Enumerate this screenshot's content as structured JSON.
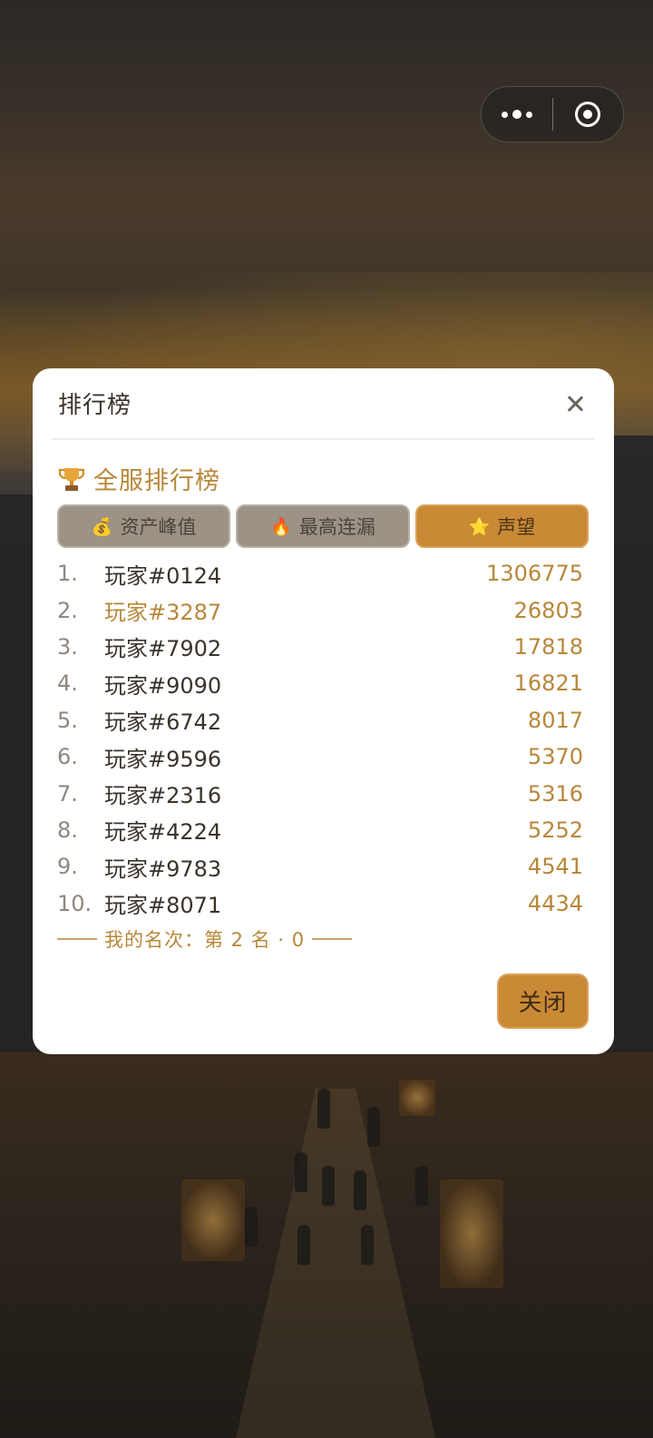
{
  "capsule": {
    "more_icon": "more-dots-icon",
    "close_icon": "target-circle-icon"
  },
  "modal": {
    "title": "排行榜",
    "close_icon": "close-x-icon",
    "section_title": "全服排行榜",
    "section_icon": "trophy-icon",
    "tabs": [
      {
        "emoji": "💰",
        "label": "资产峰值",
        "active": false
      },
      {
        "emoji": "🔥",
        "label": "最高连漏",
        "active": false
      },
      {
        "emoji": "⭐",
        "label": "声望",
        "active": true
      }
    ],
    "rows": [
      {
        "rank": "1.",
        "name": "玩家#0124",
        "score": "1306775"
      },
      {
        "rank": "2.",
        "name": "玩家#3287",
        "score": "26803",
        "me": true
      },
      {
        "rank": "3.",
        "name": "玩家#7902",
        "score": "17818"
      },
      {
        "rank": "4.",
        "name": "玩家#9090",
        "score": "16821"
      },
      {
        "rank": "5.",
        "name": "玩家#6742",
        "score": "8017"
      },
      {
        "rank": "6.",
        "name": "玩家#9596",
        "score": "5370"
      },
      {
        "rank": "7.",
        "name": "玩家#2316",
        "score": "5316"
      },
      {
        "rank": "8.",
        "name": "玩家#4224",
        "score": "5252"
      },
      {
        "rank": "9.",
        "name": "玩家#9783",
        "score": "4541"
      },
      {
        "rank": "10.",
        "name": "玩家#8071",
        "score": "4434"
      }
    ],
    "my_rank": "我的名次：第 2 名 · 0",
    "close_button": "关闭"
  },
  "colors": {
    "accent": "#c98935",
    "accent_text": "#b8873a",
    "tab_inactive": "#9c9285"
  }
}
